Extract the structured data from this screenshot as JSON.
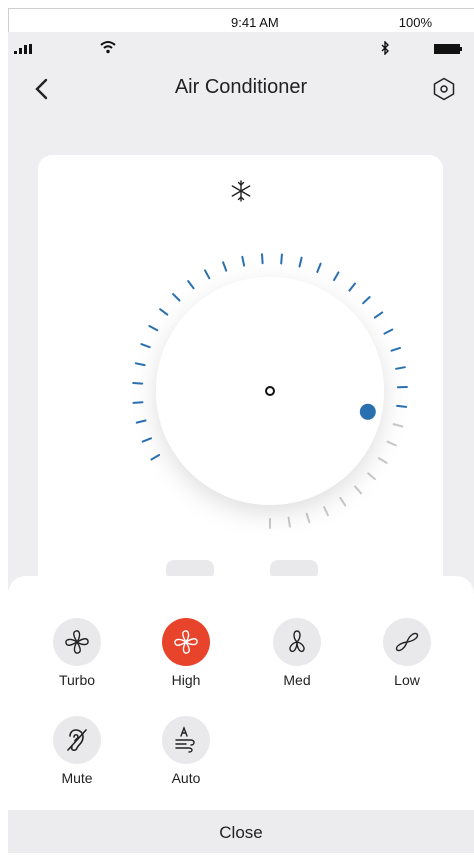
{
  "status_bar": {
    "time": "9:41 AM",
    "battery_percent": "100%"
  },
  "header": {
    "title": "Air Conditioner"
  },
  "dial": {
    "level": 0.74,
    "accent_color": "#2a70b0"
  },
  "fan_speeds": [
    {
      "label": "Turbo",
      "icon": "turbo-fan-icon",
      "active": false
    },
    {
      "label": "High",
      "icon": "high-fan-icon",
      "active": true
    },
    {
      "label": "Med",
      "icon": "med-fan-icon",
      "active": false
    },
    {
      "label": "Low",
      "icon": "low-fan-icon",
      "active": false
    },
    {
      "label": "Mute",
      "icon": "mute-ear-icon",
      "active": false
    },
    {
      "label": "Auto",
      "icon": "auto-wind-icon",
      "active": false
    }
  ],
  "close_label": "Close",
  "colors": {
    "active": "#e8432b",
    "background": "#eeeef1"
  }
}
